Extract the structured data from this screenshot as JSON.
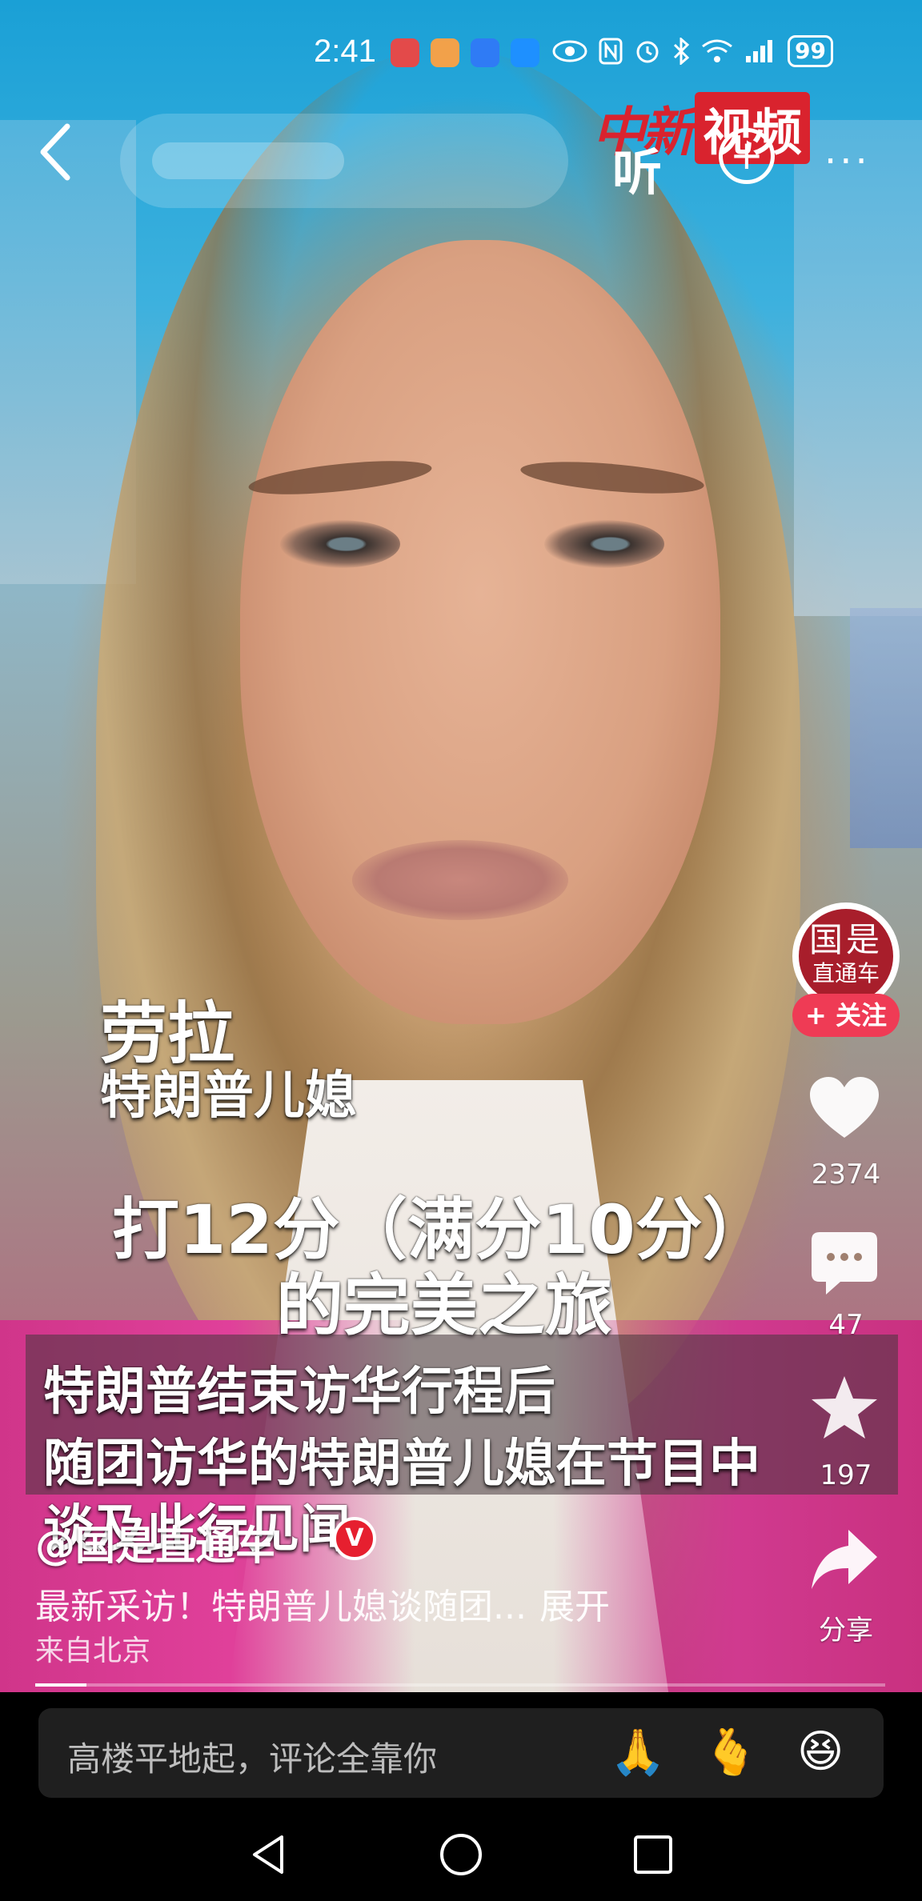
{
  "status_bar": {
    "time": "2:41",
    "app_icons": [
      "huawei-app-icon",
      "game-app-icon",
      "messaging-app-icon",
      "browser-app-icon"
    ],
    "indicators": [
      "eye-icon",
      "nfc-icon",
      "alarm-icon",
      "bluetooth-icon",
      "wifi-icon",
      "signal-icon"
    ],
    "battery": "99",
    "colors": {
      "app1": "#e34a4a",
      "app2": "#f2a14a",
      "app3": "#2f7bf5",
      "app4": "#1e90ff"
    }
  },
  "top_bar": {
    "back_icon": "back-arrow-icon",
    "logo_part1": "中新",
    "logo_part2": "视频",
    "listen_label": "听",
    "more_label": "..."
  },
  "captions": {
    "name": "劳拉",
    "role": "特朗普儿媳",
    "rating_line1": "打12分（满分10分）",
    "rating_line2": "的完美之旅",
    "subtitle_line1": "特朗普结束访华行程后",
    "subtitle_line2": "随团访华的特朗普儿媳在节目中",
    "subtitle_line3": "谈及此行见闻"
  },
  "sidebar": {
    "avatar_text_top": "国是",
    "avatar_text_bottom": "直通车",
    "follow_label": "+ 关注",
    "like_count": "2374",
    "comment_count": "47",
    "favorite_count": "197",
    "share_label": "分享"
  },
  "post": {
    "author": "@国是直通车",
    "verified_badge": "V",
    "description": "最新采访！特朗普儿媳谈随团...",
    "expand_label": "展开",
    "location": "来自北京",
    "progress": 0.06
  },
  "comment_bar": {
    "placeholder": "高楼平地起，评论全靠你",
    "emojis": [
      "🙏",
      "🫰",
      "😆"
    ]
  },
  "nav_bar": {
    "back": "nav-back-icon",
    "home": "nav-home-icon",
    "recents": "nav-recents-icon"
  }
}
